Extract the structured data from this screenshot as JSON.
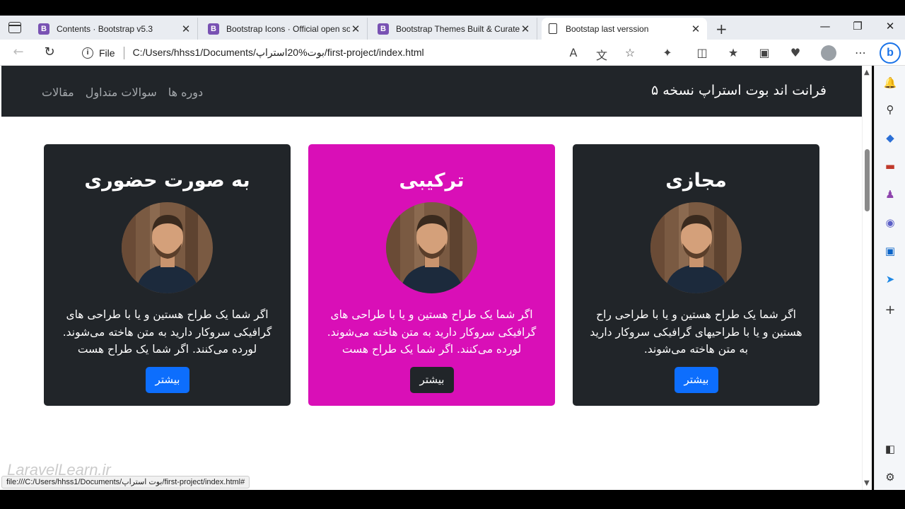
{
  "browser": {
    "tabs": [
      {
        "title": "Contents · Bootstrap v5.3",
        "favicon": "B",
        "active": false
      },
      {
        "title": "Bootstrap Icons · Official open so",
        "favicon": "B",
        "active": false
      },
      {
        "title": "Bootstrap Themes Built & Curate",
        "favicon": "B",
        "active": false
      },
      {
        "title": "Bootstap last verssion",
        "favicon": "doc",
        "active": true
      }
    ],
    "address": {
      "scheme_label": "File",
      "url": "C:/Users/hhss1/Documents/بوت%20استراپ/first-project/index.html"
    },
    "status_url": "file:///C:/Users/hhss1/Documents/بوت استراپ/first-project/index.html#"
  },
  "site": {
    "brand": "فرانت اند بوت استراپ نسخه ۵",
    "nav_links": [
      "مقالات",
      "سوالات متداول",
      "دوره ها"
    ]
  },
  "cards": [
    {
      "title": "به صورت حضوری",
      "text": "اگر شما یک طراح هستین و یا با طراحی های گرافیکی سروکار دارید به متن هاخته می‌شوند. لورده می‌کنند. اگر شما یک طراح هست",
      "button": "بیشتر",
      "variant": "dark",
      "button_variant": "primary"
    },
    {
      "title": "ترکیبی",
      "text": "اگر شما یک طراح هستین و یا با طراحی های گرافیکی سروکار دارید به متن هاخته می‌شوند. لورده می‌کنند. اگر شما یک طراح هست",
      "button": "بیشتر",
      "variant": "pink",
      "button_variant": "dark"
    },
    {
      "title": "مجازی",
      "text": "اگر شما یک طراح هستین و یا با طراحی راح هستین و یا با طراحیهای گرافیکی سروکار دارید به متن هاخته می‌شوند.",
      "button": "بیشتر",
      "variant": "dark",
      "button_variant": "primary"
    }
  ],
  "colors": {
    "navbar": "#212529",
    "card_pink": "#d90fb7",
    "btn_primary": "#0d6efd"
  },
  "watermark": "LaravelLearn.ir"
}
